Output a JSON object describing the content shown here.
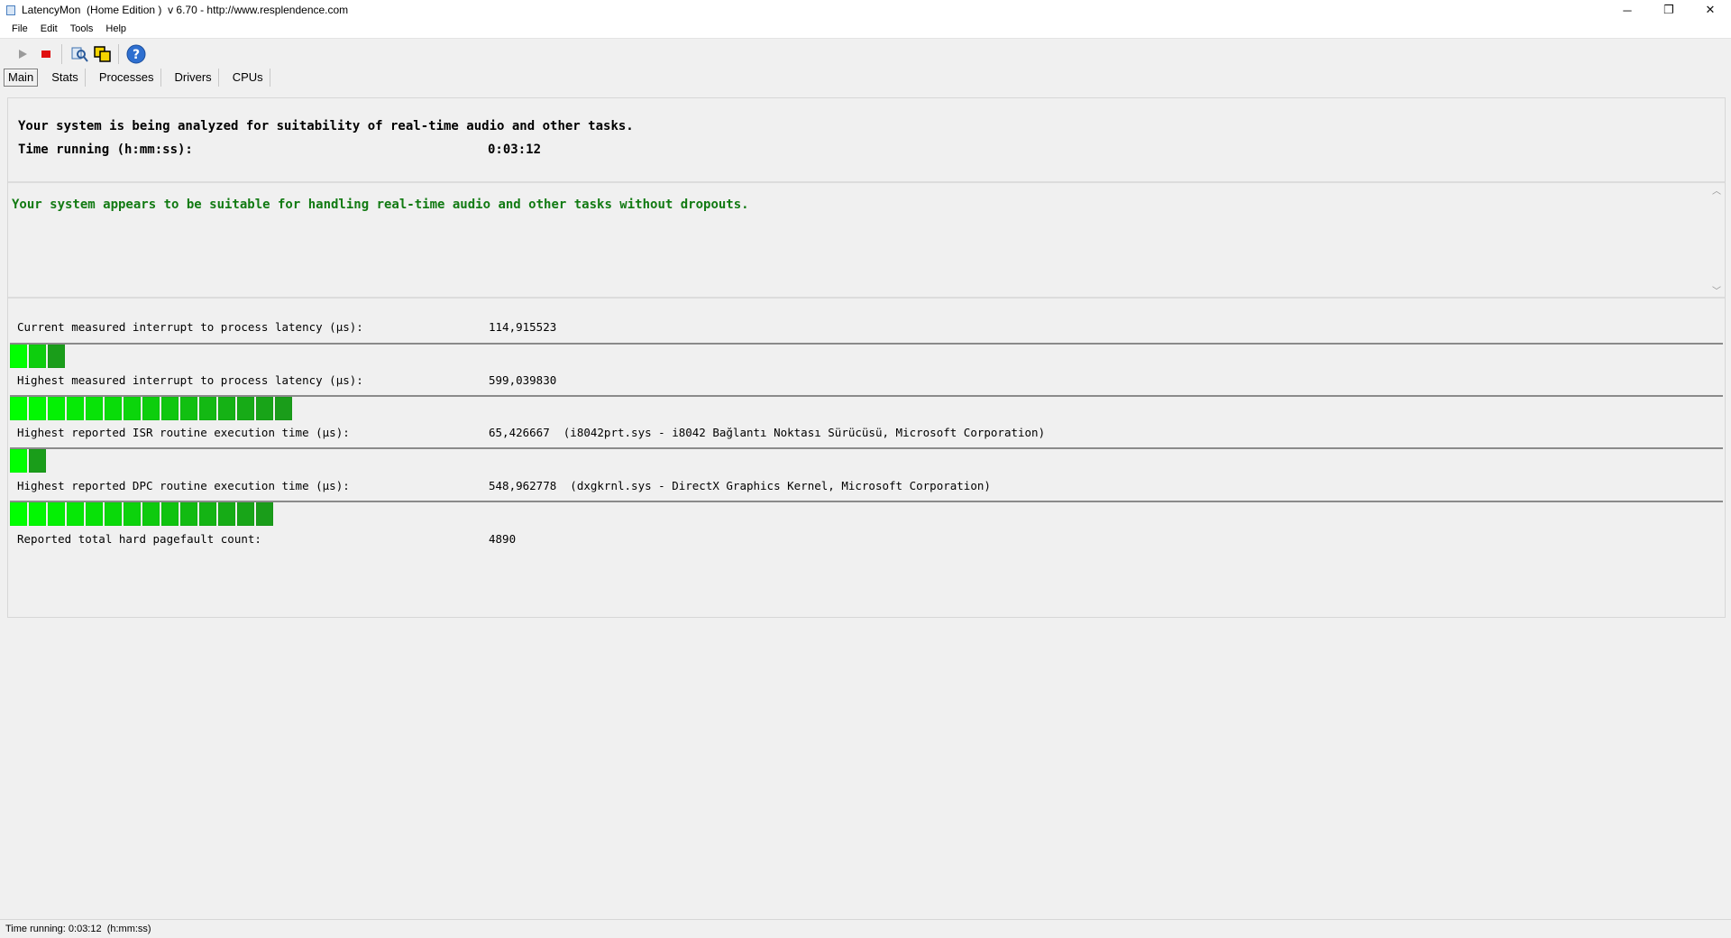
{
  "window": {
    "title": "LatencyMon  (Home Edition )  v 6.70 - http://www.resplendence.com",
    "minimize": "─",
    "maximize": "❐",
    "close": "✕"
  },
  "menu": [
    "File",
    "Edit",
    "Tools",
    "Help"
  ],
  "toolbar": {
    "start_icon": "play-icon",
    "stop_icon": "stop-icon",
    "report_icon": "report-icon",
    "copy_icon": "copy-icon",
    "help_icon": "help-icon"
  },
  "tabs": [
    "Main",
    "Stats",
    "Processes",
    "Drivers",
    "CPUs"
  ],
  "active_tab": "Main",
  "analysis": {
    "line1": "Your system is being analyzed for suitability of real-time audio and other tasks.",
    "time_label": "Time running (h:mm:ss):",
    "time_value": "0:03:12"
  },
  "verdict": "Your system appears to be suitable for handling real-time audio and other tasks without dropouts.",
  "metrics": [
    {
      "label": "Current measured interrupt to process latency (µs):",
      "value": "114,915523",
      "bar_segments": 3
    },
    {
      "label": "Highest measured interrupt to process latency (µs):",
      "value": "599,039830",
      "bar_segments": 15
    },
    {
      "label": "Highest reported ISR routine execution time (µs):",
      "value": "65,426667  (i8042prt.sys - i8042 Bağlantı Noktası Sürücüsü, Microsoft Corporation)",
      "bar_segments": 2
    },
    {
      "label": "Highest reported DPC routine execution time (µs):",
      "value": "548,962778  (dxgkrnl.sys - DirectX Graphics Kernel, Microsoft Corporation)",
      "bar_segments": 14
    },
    {
      "label": "Reported total hard pagefault count:",
      "value": "4890"
    }
  ],
  "colors": {
    "verdict_green": "#117a12",
    "bar_bright": "#00ff00",
    "bar_dark": "#1f8c1f"
  },
  "status": "Time running: 0:03:12  (h:mm:ss)"
}
